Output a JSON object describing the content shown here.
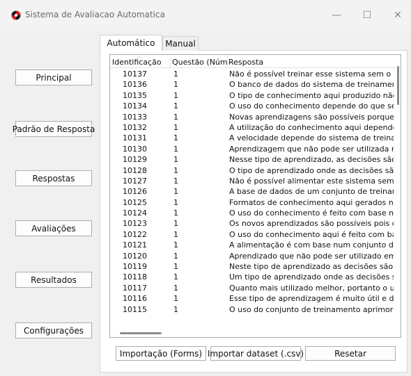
{
  "window": {
    "title": "Sistema de Avaliacao Automatica",
    "minimize_glyph": "—",
    "maximize_glyph": "☐",
    "close_glyph": "✕"
  },
  "sidebar": {
    "buttons": [
      {
        "label": "Principal"
      },
      {
        "label": "Padrão de Resposta"
      },
      {
        "label": "Respostas"
      },
      {
        "label": "Avaliações"
      },
      {
        "label": "Resultados"
      },
      {
        "label": "Configurações"
      }
    ]
  },
  "tabs": [
    {
      "label": "Automático",
      "active": true
    },
    {
      "label": "Manual",
      "active": false
    }
  ],
  "table": {
    "columns": [
      "Identificação",
      "Questão (Núme",
      "Resposta"
    ],
    "rows": [
      [
        "10137",
        "1",
        "Não é possível treinar esse sistema sem o uso d"
      ],
      [
        "10136",
        "1",
        "O banco de dados do sistema de treinamento é"
      ],
      [
        "10135",
        "1",
        "O tipo de conhecimento aqui produzido não ut"
      ],
      [
        "10134",
        "1",
        "O uso do conhecimento depende do que se que"
      ],
      [
        "10133",
        "1",
        "Novas aprendizagens são possíveis porque o sis"
      ],
      [
        "10132",
        "1",
        "A utilização do conhecimento aqui depende dc"
      ],
      [
        "10131",
        "1",
        "A velocidade depende do sistema de treinamer"
      ],
      [
        "10130",
        "1",
        "Aprendizagem que não pode ser utilizada nos p"
      ],
      [
        "10129",
        "1",
        "Nesse tipo de aprendizado, as decisões são ton"
      ],
      [
        "10128",
        "1",
        "O tipo de aprendizado onde as decisões são ba"
      ],
      [
        "10127",
        "1",
        "Não é possível alimentar este sistema sem o usu"
      ],
      [
        "10126",
        "1",
        "A base de dados de um conjunto de treinament"
      ],
      [
        "10125",
        "1",
        "Formatos de conhecimento aqui gerados não fa"
      ],
      [
        "10124",
        "1",
        "O uso do conhecimento é feito com base naqui"
      ],
      [
        "10123",
        "1",
        "Os novos aprendizados são possíveis pois o sist"
      ],
      [
        "10122",
        "1",
        "O uso do conhecimento aqui é feito com base r"
      ],
      [
        "10121",
        "1",
        "A alimentação é com base num conjunto de tre"
      ],
      [
        "10120",
        "1",
        "Aprendizado que não pode ser utilizado em sis"
      ],
      [
        "10119",
        "1",
        "Neste tipo de aprendizado as decisões são base"
      ],
      [
        "10118",
        "1",
        "Um tipo de aprendizado onde as decisões são b"
      ],
      [
        "10117",
        "1",
        "Quanto mais utilizado melhor, portanto o uso d"
      ],
      [
        "10116",
        "1",
        "Esse tipo de aprendizagem é muito útil e demo"
      ],
      [
        "10115",
        "1",
        "O uso do conjunto de treinamento aprimora o f"
      ]
    ]
  },
  "actions": {
    "import_forms": "Importação (Forms)",
    "import_csv": "Importar dataset (.csv)",
    "reset": "Resetar"
  }
}
